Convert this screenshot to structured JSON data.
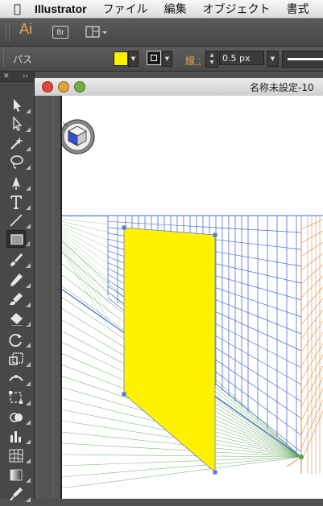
{
  "menubar": {
    "app_name": "Illustrator",
    "items": [
      "ファイル",
      "編集",
      "オブジェクト",
      "書式"
    ]
  },
  "appbar": {
    "logo": "Ai",
    "bridge_label": "Br"
  },
  "controlbar": {
    "object_type": "パス",
    "fill_color": "#fff200",
    "stroke_label": "線 :",
    "stroke_weight": "0.5 px"
  },
  "document": {
    "title": "名称未設定-10"
  },
  "tools": [
    "selection-tool",
    "direct-selection-tool",
    "magic-wand-tool",
    "lasso-tool",
    "pen-tool",
    "type-tool",
    "line-segment-tool",
    "rectangle-tool",
    "paintbrush-tool",
    "pencil-tool",
    "blob-brush-tool",
    "eraser-tool",
    "rotate-tool",
    "scale-tool",
    "width-tool",
    "free-transform-tool",
    "shape-builder-tool",
    "column-graph-tool",
    "mesh-tool",
    "gradient-tool",
    "eyedropper-tool"
  ],
  "colors": {
    "accent": "#e8a25a",
    "plane_fill": "#fff200",
    "grid_left": "#4a6fd8",
    "grid_right": "#e08a3c",
    "grid_floor": "#5aa050"
  }
}
